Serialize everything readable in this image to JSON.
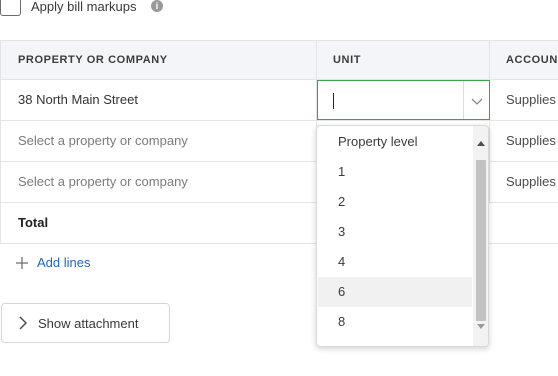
{
  "markups": {
    "label": "Apply bill markups",
    "info_glyph": "i",
    "checked": false
  },
  "table": {
    "headers": {
      "property": "PROPERTY OR COMPANY",
      "unit": "UNIT",
      "account": "ACCOUN"
    },
    "rows": [
      {
        "property": "38 North Main Street",
        "account": "Supplies"
      },
      {
        "property": "Select a property or company",
        "account": "Supplies"
      },
      {
        "property": "Select a property or company",
        "account": "Supplies"
      }
    ],
    "total_label": "Total"
  },
  "unit_input": {
    "value": ""
  },
  "dropdown": {
    "options": [
      "Property level",
      "1",
      "2",
      "3",
      "4",
      "6",
      "8"
    ],
    "hovered": "6"
  },
  "actions": {
    "add_lines": "Add lines",
    "show_attachment": "Show attachment"
  },
  "colors": {
    "focus_border": "#3aa64a",
    "link": "#1f6bb5",
    "header_bg": "#f4f5f8"
  }
}
